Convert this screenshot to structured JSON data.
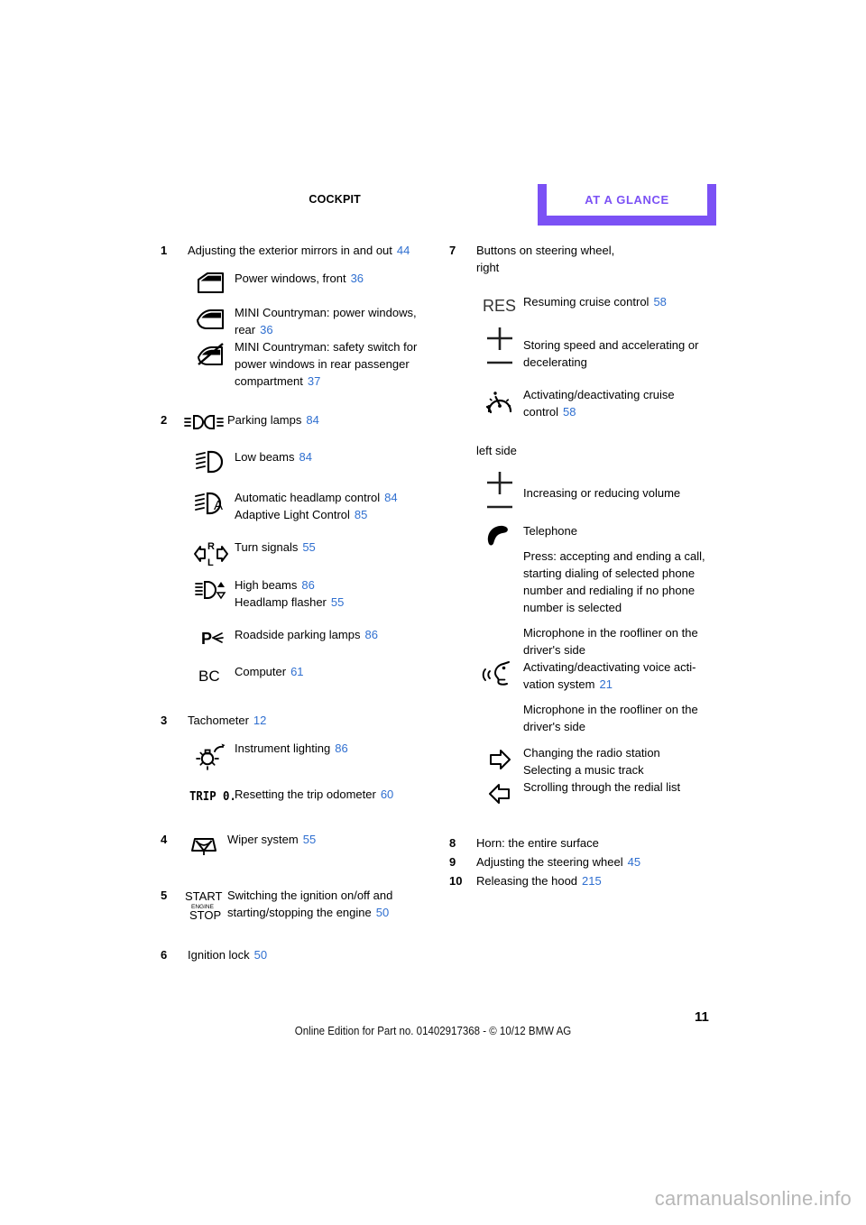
{
  "header": {
    "section_label": "COCKPIT",
    "tab_label": "AT A GLANCE"
  },
  "left_column": {
    "items": [
      {
        "number": "1",
        "title": "Adjusting the exterior mirrors in and out",
        "page": "44",
        "rows": [
          {
            "icon": "car-door-front-window-icon",
            "lines": [
              {
                "text": "Power windows, front",
                "page": "36"
              }
            ]
          },
          {
            "icon": "car-door-rear-window-icon",
            "lines": [
              {
                "text": "MINI Countryman: power windows,",
                "page": ""
              },
              {
                "text": "rear",
                "page": "36"
              }
            ]
          },
          {
            "icon": "power-window-safety-switch-icon",
            "lines": [
              {
                "text": "MINI Countryman: safety switch for",
                "page": ""
              },
              {
                "text": "power windows in rear passenger",
                "page": ""
              },
              {
                "text": "compartment",
                "page": "37"
              }
            ]
          }
        ]
      },
      {
        "number": "2",
        "title": "",
        "page": "",
        "rows": [
          {
            "icon": "parking-lamps-icon",
            "lines": [
              {
                "text": "Parking lamps",
                "page": "84"
              }
            ]
          },
          {
            "icon": "low-beams-icon",
            "lines": [
              {
                "text": "Low beams",
                "page": "84"
              }
            ]
          },
          {
            "icon": "automatic-headlamp-control-icon",
            "lines": [
              {
                "text": "Automatic headlamp control",
                "page": "84"
              },
              {
                "text": "Adaptive Light Control",
                "page": "85"
              }
            ]
          },
          {
            "icon": "turn-signals-icon",
            "lines": [
              {
                "text": "Turn signals",
                "page": "55"
              }
            ]
          },
          {
            "icon": "high-beams-flasher-icon",
            "lines": [
              {
                "text": "High beams",
                "page": "86"
              },
              {
                "text": "Headlamp flasher",
                "page": "55"
              }
            ]
          },
          {
            "icon": "roadside-parking-lamps-icon",
            "lines": [
              {
                "text": "Roadside parking lamps",
                "page": "86"
              }
            ]
          },
          {
            "icon": "board-computer-icon",
            "lines": [
              {
                "text": "Computer",
                "page": "61"
              }
            ]
          }
        ]
      },
      {
        "number": "3",
        "title": "Tachometer",
        "page": "12",
        "rows": [
          {
            "icon": "instrument-lighting-icon",
            "lines": [
              {
                "text": "Instrument lighting",
                "page": "86"
              }
            ]
          },
          {
            "icon": "trip-odometer-icon",
            "lines": [
              {
                "text": "Resetting the trip odometer",
                "page": "60"
              }
            ]
          }
        ]
      },
      {
        "number": "4",
        "title": "",
        "page": "",
        "rows": [
          {
            "icon": "wiper-system-icon",
            "lines": [
              {
                "text": "Wiper system",
                "page": "55"
              }
            ]
          }
        ]
      },
      {
        "number": "5",
        "title": "",
        "page": "",
        "rows": [
          {
            "icon": "start-stop-engine-icon",
            "lines": [
              {
                "text": "Switching the ignition on/off and",
                "page": ""
              },
              {
                "text": "starting/stopping the engine",
                "page": "50"
              }
            ]
          }
        ]
      },
      {
        "number": "6",
        "title": "Ignition lock",
        "page": "50",
        "rows": []
      }
    ]
  },
  "right_column": {
    "item7": {
      "number": "7",
      "title_line1": "Buttons on steering wheel,",
      "title_line2": "right",
      "rows": [
        {
          "icon": "res-button-icon",
          "lines": [
            {
              "text": "Resuming cruise control",
              "page": "58"
            }
          ]
        },
        {
          "icon": "plus-minus-rocker-icon",
          "lines": [
            {
              "text": "Storing speed and accelerating or",
              "page": ""
            },
            {
              "text": "decelerating",
              "page": ""
            }
          ]
        },
        {
          "icon": "cruise-control-icon",
          "lines": [
            {
              "text": "Activating/deactivating cruise",
              "page": ""
            },
            {
              "text": "control",
              "page": "58"
            }
          ]
        }
      ],
      "left_side_label": "left side",
      "left_rows": [
        {
          "icon": "plus-minus-rocker-icon",
          "lines": [
            {
              "text": "Increasing or reducing volume",
              "page": ""
            }
          ]
        },
        {
          "icon": "telephone-handset-icon",
          "lines": [
            {
              "text": "Telephone",
              "page": ""
            }
          ],
          "paragraphs": [
            [
              {
                "text": "Press: accepting and ending a call,",
                "page": ""
              },
              {
                "text": "starting dialing of selected phone",
                "page": ""
              },
              {
                "text": "number and redialing if no phone",
                "page": ""
              },
              {
                "text": "number is selected",
                "page": ""
              }
            ],
            [
              {
                "text": "Microphone in the roofliner on the",
                "page": ""
              },
              {
                "text": "driver's side",
                "page": ""
              }
            ]
          ]
        },
        {
          "icon": "voice-activation-icon",
          "lines": [
            {
              "text": "Activating/deactivating voice acti-",
              "page": ""
            },
            {
              "text": "vation system",
              "page": "21"
            }
          ],
          "paragraphs": [
            [
              {
                "text": "Microphone in the roofliner on the",
                "page": ""
              },
              {
                "text": "driver's side",
                "page": ""
              }
            ]
          ]
        },
        {
          "icon": "arrow-right-icon",
          "lines": [
            {
              "text": "Changing the radio station",
              "page": ""
            },
            {
              "text": "Selecting a music track",
              "page": ""
            }
          ]
        },
        {
          "icon": "arrow-left-icon",
          "lines": [
            {
              "text": "Scrolling through the redial list",
              "page": ""
            }
          ]
        }
      ]
    },
    "items": [
      {
        "number": "8",
        "title": "Horn: the entire surface",
        "page": ""
      },
      {
        "number": "9",
        "title": "Adjusting the steering wheel",
        "page": "45"
      },
      {
        "number": "10",
        "title": "Releasing the hood",
        "page": "215"
      }
    ]
  },
  "footer": {
    "edition_text": "Online Edition for Part no. 01402917368 - © 10/12 BMW AG",
    "page_number": "11",
    "watermark": "carmanualsonline.info"
  },
  "colors": {
    "accent": "#7b51f5",
    "page_ref": "#2f6fd0",
    "watermark": "#b7b7b7"
  }
}
